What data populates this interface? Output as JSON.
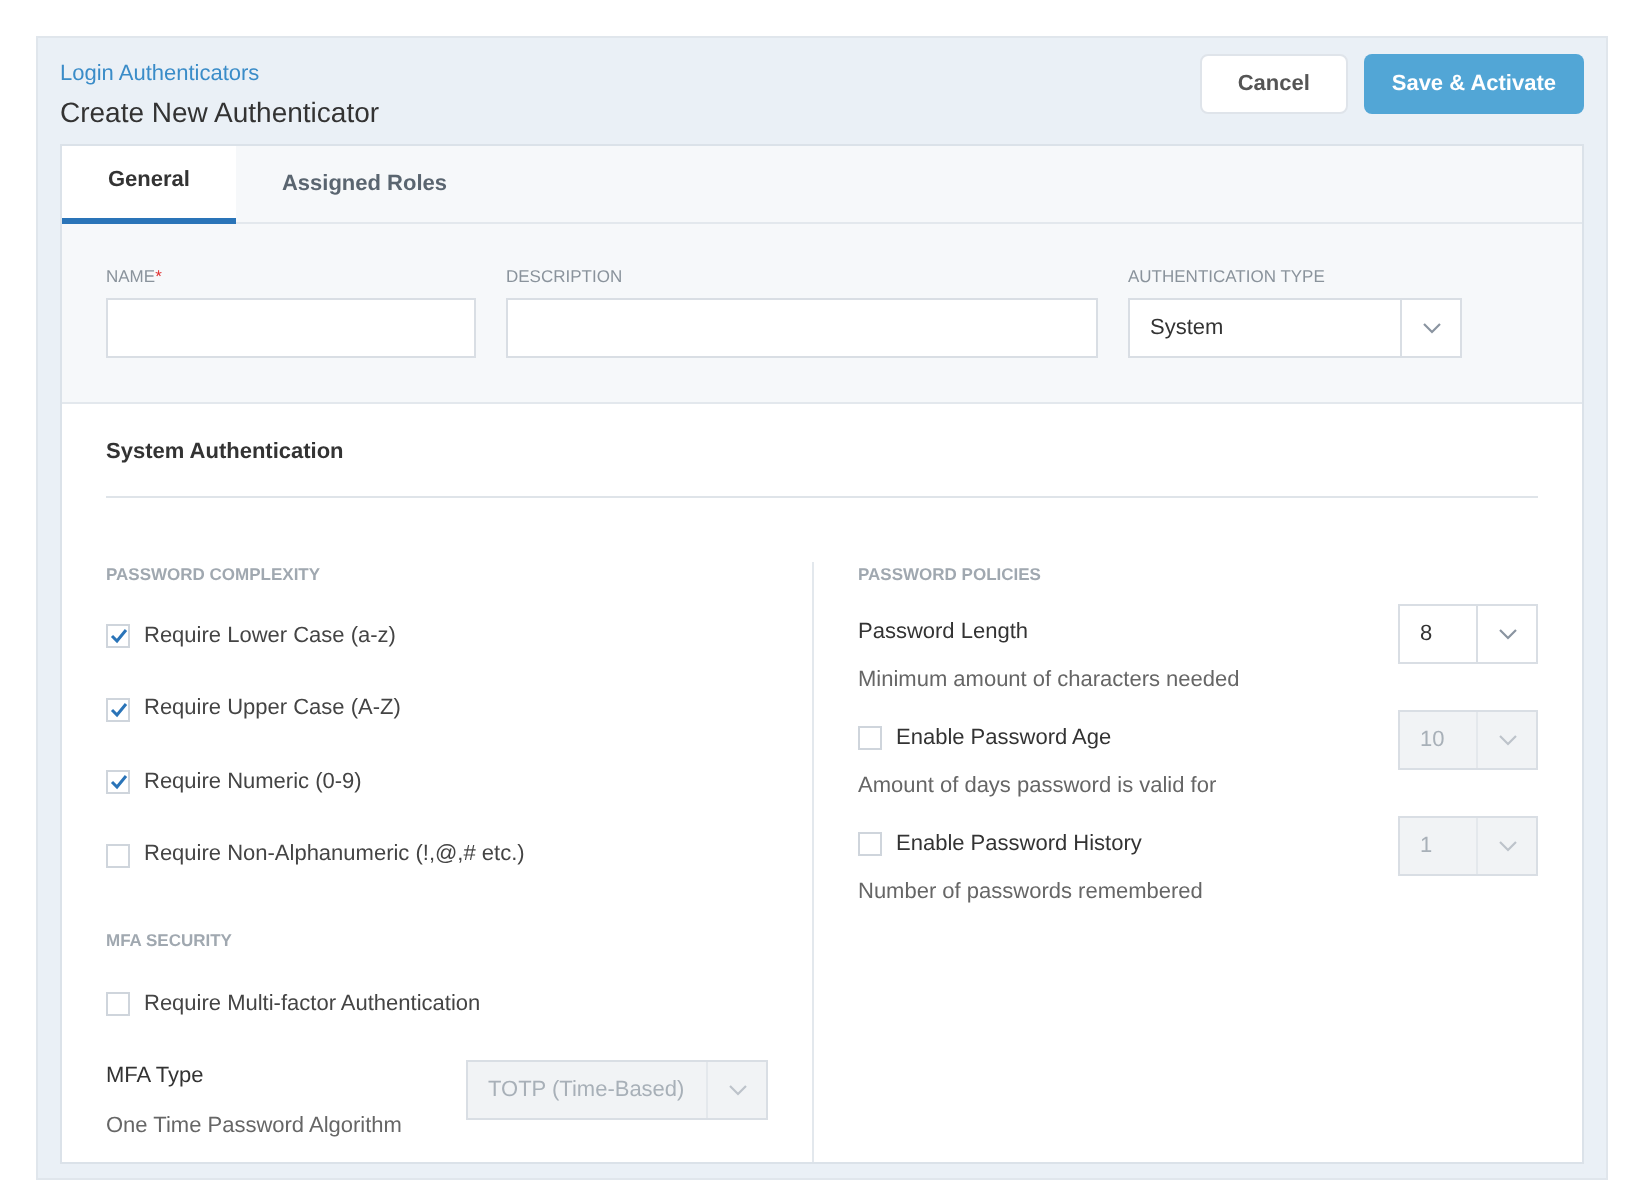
{
  "header": {
    "breadcrumb": "Login Authenticators",
    "title": "Create New Authenticator",
    "buttons": [
      {
        "label": "Cancel",
        "kind": "secondary"
      },
      {
        "label": "Save & Activate",
        "kind": "primary"
      }
    ]
  },
  "tabs": [
    {
      "label": "General",
      "selected": true
    },
    {
      "label": "Assigned Roles",
      "selected": false
    }
  ],
  "fields": [
    {
      "label": "NAME",
      "required_mark": "*",
      "kind": "text"
    },
    {
      "label": "DESCRIPTION",
      "kind": "text"
    },
    {
      "label": "AUTHENTICATION TYPE",
      "kind": "select",
      "value": "System"
    }
  ],
  "section_title": "System Authentication",
  "complexity": {
    "heading": "PASSWORD COMPLEXITY",
    "options": [
      {
        "label": "Require Lower Case (a-z)",
        "checked": true
      },
      {
        "label": "Require Upper Case (A-Z)",
        "checked": true
      },
      {
        "label": "Require Numeric (0-9)",
        "checked": true
      },
      {
        "label": "Require Non-Alphanumeric (!,@,# etc.)",
        "checked": false
      }
    ]
  },
  "mfa": {
    "heading": "MFA SECURITY",
    "option": {
      "label": "Require Multi-factor Authentication",
      "checked": false
    },
    "type_label": "MFA Type",
    "type_hint": "One Time Password Algorithm",
    "type_value": "TOTP (Time-Based)",
    "type_disabled": true
  },
  "policies": {
    "heading": "PASSWORD POLICIES",
    "rows": [
      {
        "kind": "plain",
        "label": "Password Length",
        "hint": "Minimum amount of characters needed",
        "value": "8",
        "disabled": false
      },
      {
        "kind": "toggle",
        "label": "Enable Password Age",
        "checked": false,
        "hint": "Amount of days password is valid for",
        "value": "10",
        "disabled": true
      },
      {
        "kind": "toggle",
        "label": "Enable Password History",
        "checked": false,
        "hint": "Number of passwords remembered",
        "value": "1",
        "disabled": true
      }
    ]
  }
}
